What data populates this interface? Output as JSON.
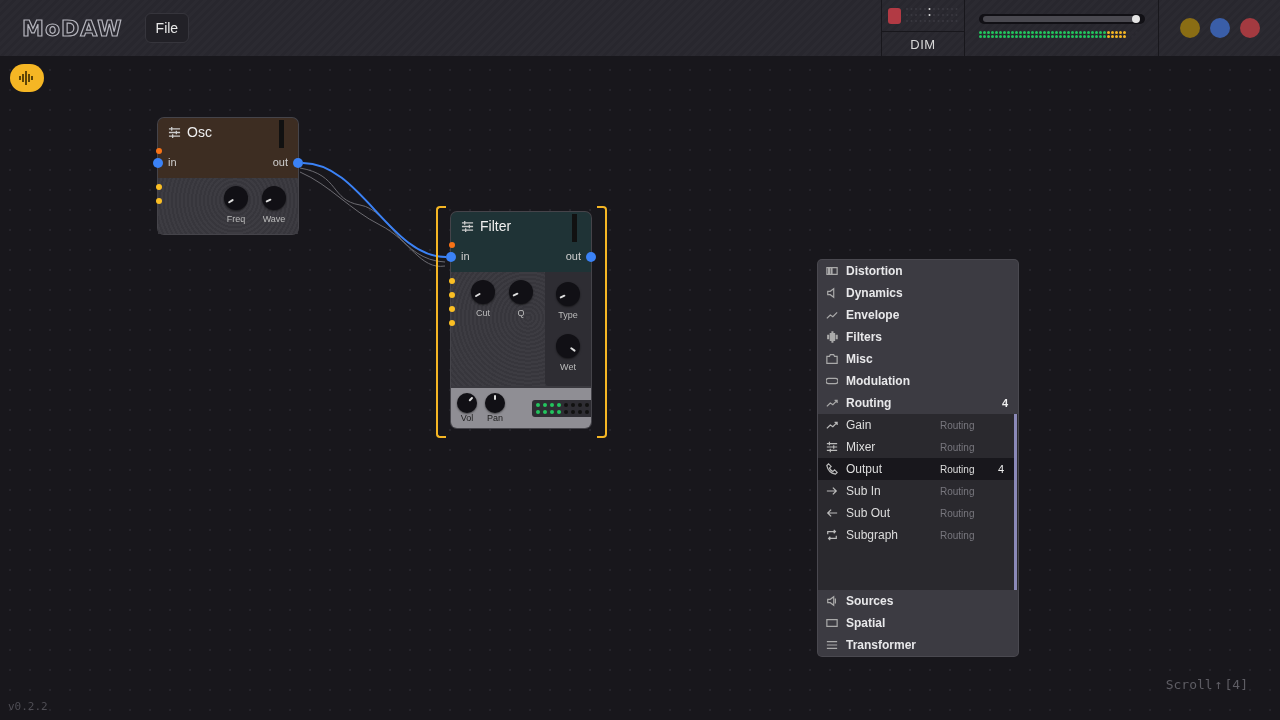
{
  "header": {
    "logo": "MoDAW",
    "menu_button": "File",
    "monitor": {
      "label": "DIM"
    },
    "volume": {
      "level": 0.97
    },
    "window_dots": [
      {
        "color": "#8a6d14"
      },
      {
        "color": "#3a5ea8"
      },
      {
        "color": "#a33a40"
      }
    ]
  },
  "canvas": {
    "toggle": {
      "on": true
    },
    "nodes": [
      {
        "title": "Osc",
        "selected": false,
        "input": "in",
        "output": "out",
        "side_ports": [
          {
            "color": "#f97316"
          },
          {
            "color": "#fbbf24"
          },
          {
            "color": "#fbbf24"
          }
        ],
        "knobs": [
          {
            "label": "Freq"
          },
          {
            "label": "Wave"
          }
        ]
      },
      {
        "title": "Filter",
        "selected": true,
        "input": "in",
        "output": "out",
        "side_ports": [
          {
            "color": "#f97316"
          },
          {
            "color": "#fbbf24"
          },
          {
            "color": "#fbbf24"
          },
          {
            "color": "#fbbf24"
          },
          {
            "color": "#fbbf24"
          }
        ],
        "knobs": [
          {
            "label": "Cut"
          },
          {
            "label": "Q"
          }
        ],
        "side_knobs": [
          {
            "label": "Type"
          },
          {
            "label": "Wet"
          }
        ],
        "footer": {
          "knobs": [
            {
              "label": "Vol"
            },
            {
              "label": "Pan"
            }
          ]
        }
      }
    ]
  },
  "menu": {
    "categories": [
      {
        "name": "Distortion"
      },
      {
        "name": "Dynamics"
      },
      {
        "name": "Envelope"
      },
      {
        "name": "Filters"
      },
      {
        "name": "Misc"
      },
      {
        "name": "Modulation"
      },
      {
        "name": "Routing",
        "count": "4",
        "children": [
          {
            "name": "Gain",
            "tag": "Routing",
            "selected": false
          },
          {
            "name": "Mixer",
            "tag": "Routing",
            "selected": false
          },
          {
            "name": "Output",
            "tag": "Routing",
            "count": "4",
            "selected": true
          },
          {
            "name": "Sub In",
            "tag": "Routing",
            "selected": false
          },
          {
            "name": "Sub Out",
            "tag": "Routing",
            "selected": false
          },
          {
            "name": "Subgraph",
            "tag": "Routing",
            "selected": false
          }
        ]
      },
      {
        "name": "Sources"
      },
      {
        "name": "Spatial"
      },
      {
        "name": "Transformer"
      }
    ]
  },
  "hint": {
    "text": "Scroll",
    "arrow": "↑",
    "count": "[4]"
  },
  "version": "v0.2.2"
}
